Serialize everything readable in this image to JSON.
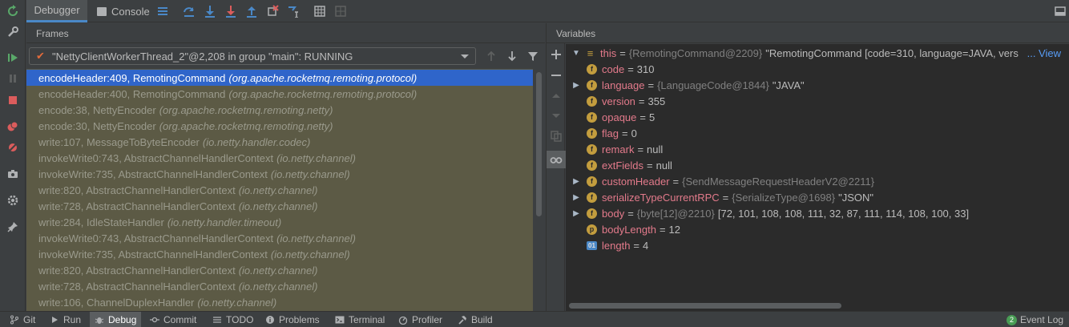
{
  "toolbar": {
    "tab_debugger": "Debugger",
    "tab_console": "Console"
  },
  "frames": {
    "header": "Frames",
    "thread": "\"NettyClientWorkerThread_2\"@2,208 in group \"main\": RUNNING",
    "items": [
      {
        "method": "encodeHeader:409, RemotingCommand",
        "pkg": "(org.apache.rocketmq.remoting.protocol)"
      },
      {
        "method": "encodeHeader:400, RemotingCommand",
        "pkg": "(org.apache.rocketmq.remoting.protocol)"
      },
      {
        "method": "encode:38, NettyEncoder",
        "pkg": "(org.apache.rocketmq.remoting.netty)"
      },
      {
        "method": "encode:30, NettyEncoder",
        "pkg": "(org.apache.rocketmq.remoting.netty)"
      },
      {
        "method": "write:107, MessageToByteEncoder",
        "pkg": "(io.netty.handler.codec)"
      },
      {
        "method": "invokeWrite0:743, AbstractChannelHandlerContext",
        "pkg": "(io.netty.channel)"
      },
      {
        "method": "invokeWrite:735, AbstractChannelHandlerContext",
        "pkg": "(io.netty.channel)"
      },
      {
        "method": "write:820, AbstractChannelHandlerContext",
        "pkg": "(io.netty.channel)"
      },
      {
        "method": "write:728, AbstractChannelHandlerContext",
        "pkg": "(io.netty.channel)"
      },
      {
        "method": "write:284, IdleStateHandler",
        "pkg": "(io.netty.handler.timeout)"
      },
      {
        "method": "invokeWrite0:743, AbstractChannelHandlerContext",
        "pkg": "(io.netty.channel)"
      },
      {
        "method": "invokeWrite:735, AbstractChannelHandlerContext",
        "pkg": "(io.netty.channel)"
      },
      {
        "method": "write:820, AbstractChannelHandlerContext",
        "pkg": "(io.netty.channel)"
      },
      {
        "method": "write:728, AbstractChannelHandlerContext",
        "pkg": "(io.netty.channel)"
      },
      {
        "method": "write:106, ChannelDuplexHandler",
        "pkg": "(io.netty.channel)"
      }
    ]
  },
  "variables": {
    "header": "Variables",
    "this_name": "this",
    "this_type": "{RemotingCommand@2209}",
    "this_value": "\"RemotingCommand [code=310, language=JAVA, vers",
    "view_link": "... View",
    "rows": [
      {
        "name": "code",
        "type": "",
        "value": "310"
      },
      {
        "name": "language",
        "type": "{LanguageCode@1844}",
        "value": "\"JAVA\""
      },
      {
        "name": "version",
        "type": "",
        "value": "355"
      },
      {
        "name": "opaque",
        "type": "",
        "value": "5"
      },
      {
        "name": "flag",
        "type": "",
        "value": "0"
      },
      {
        "name": "remark",
        "type": "",
        "value": "null"
      },
      {
        "name": "extFields",
        "type": "",
        "value": "null"
      },
      {
        "name": "customHeader",
        "type": "{SendMessageRequestHeaderV2@2211}",
        "value": ""
      },
      {
        "name": "serializeTypeCurrentRPC",
        "type": "{SerializeType@1698}",
        "value": "\"JSON\""
      },
      {
        "name": "body",
        "type": "{byte[12]@2210}",
        "value": "[72, 101, 108, 108, 111, 32, 87, 111, 114, 108, 100, 33]"
      }
    ],
    "body_length_name": "bodyLength",
    "body_length_value": "12",
    "length_name": "length",
    "length_value": "4",
    "badge_f": "f",
    "badge_p": "p",
    "badge_arr": "01",
    "eq": "="
  },
  "status_bar": {
    "git": "Git",
    "run": "Run",
    "debug": "Debug",
    "commit": "Commit",
    "todo": "TODO",
    "problems": "Problems",
    "terminal": "Terminal",
    "profiler": "Profiler",
    "build": "Build",
    "event_log": "Event Log",
    "event_count": "2"
  },
  "colors": {
    "accent": "#4a88c7",
    "selection": "#2f65ca",
    "frames_bg": "#5c5a45",
    "field_name": "#e37a8b",
    "badge": "#c39d3e"
  }
}
